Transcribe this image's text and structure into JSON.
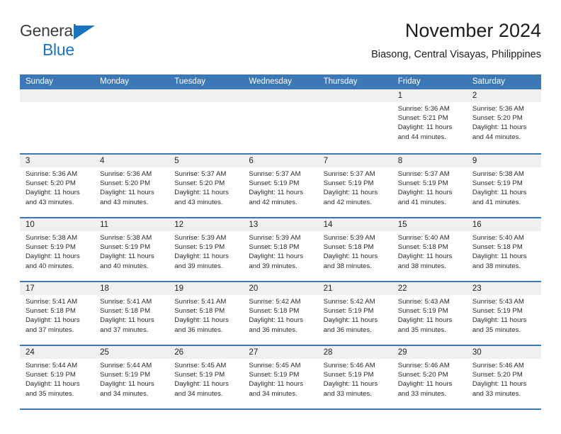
{
  "brand": {
    "name_part1": "General",
    "name_part2": "Blue",
    "accent_color": "#1a74bb"
  },
  "header": {
    "title": "November 2024",
    "subtitle": "Biasong, Central Visayas, Philippines"
  },
  "calendar": {
    "header_color": "#3b78b5",
    "day_header_bg": "#f0f0f0",
    "weekday_labels": [
      "Sunday",
      "Monday",
      "Tuesday",
      "Wednesday",
      "Thursday",
      "Friday",
      "Saturday"
    ],
    "weeks": [
      [
        {
          "day": "",
          "sunrise": "",
          "sunset": "",
          "daylight": "",
          "empty": true
        },
        {
          "day": "",
          "sunrise": "",
          "sunset": "",
          "daylight": "",
          "empty": true
        },
        {
          "day": "",
          "sunrise": "",
          "sunset": "",
          "daylight": "",
          "empty": true
        },
        {
          "day": "",
          "sunrise": "",
          "sunset": "",
          "daylight": "",
          "empty": true
        },
        {
          "day": "",
          "sunrise": "",
          "sunset": "",
          "daylight": "",
          "empty": true
        },
        {
          "day": "1",
          "sunrise": "Sunrise: 5:36 AM",
          "sunset": "Sunset: 5:21 PM",
          "daylight": "Daylight: 11 hours and 44 minutes."
        },
        {
          "day": "2",
          "sunrise": "Sunrise: 5:36 AM",
          "sunset": "Sunset: 5:20 PM",
          "daylight": "Daylight: 11 hours and 44 minutes."
        }
      ],
      [
        {
          "day": "3",
          "sunrise": "Sunrise: 5:36 AM",
          "sunset": "Sunset: 5:20 PM",
          "daylight": "Daylight: 11 hours and 43 minutes."
        },
        {
          "day": "4",
          "sunrise": "Sunrise: 5:36 AM",
          "sunset": "Sunset: 5:20 PM",
          "daylight": "Daylight: 11 hours and 43 minutes."
        },
        {
          "day": "5",
          "sunrise": "Sunrise: 5:37 AM",
          "sunset": "Sunset: 5:20 PM",
          "daylight": "Daylight: 11 hours and 43 minutes."
        },
        {
          "day": "6",
          "sunrise": "Sunrise: 5:37 AM",
          "sunset": "Sunset: 5:19 PM",
          "daylight": "Daylight: 11 hours and 42 minutes."
        },
        {
          "day": "7",
          "sunrise": "Sunrise: 5:37 AM",
          "sunset": "Sunset: 5:19 PM",
          "daylight": "Daylight: 11 hours and 42 minutes."
        },
        {
          "day": "8",
          "sunrise": "Sunrise: 5:37 AM",
          "sunset": "Sunset: 5:19 PM",
          "daylight": "Daylight: 11 hours and 41 minutes."
        },
        {
          "day": "9",
          "sunrise": "Sunrise: 5:38 AM",
          "sunset": "Sunset: 5:19 PM",
          "daylight": "Daylight: 11 hours and 41 minutes."
        }
      ],
      [
        {
          "day": "10",
          "sunrise": "Sunrise: 5:38 AM",
          "sunset": "Sunset: 5:19 PM",
          "daylight": "Daylight: 11 hours and 40 minutes."
        },
        {
          "day": "11",
          "sunrise": "Sunrise: 5:38 AM",
          "sunset": "Sunset: 5:19 PM",
          "daylight": "Daylight: 11 hours and 40 minutes."
        },
        {
          "day": "12",
          "sunrise": "Sunrise: 5:39 AM",
          "sunset": "Sunset: 5:19 PM",
          "daylight": "Daylight: 11 hours and 39 minutes."
        },
        {
          "day": "13",
          "sunrise": "Sunrise: 5:39 AM",
          "sunset": "Sunset: 5:18 PM",
          "daylight": "Daylight: 11 hours and 39 minutes."
        },
        {
          "day": "14",
          "sunrise": "Sunrise: 5:39 AM",
          "sunset": "Sunset: 5:18 PM",
          "daylight": "Daylight: 11 hours and 38 minutes."
        },
        {
          "day": "15",
          "sunrise": "Sunrise: 5:40 AM",
          "sunset": "Sunset: 5:18 PM",
          "daylight": "Daylight: 11 hours and 38 minutes."
        },
        {
          "day": "16",
          "sunrise": "Sunrise: 5:40 AM",
          "sunset": "Sunset: 5:18 PM",
          "daylight": "Daylight: 11 hours and 38 minutes."
        }
      ],
      [
        {
          "day": "17",
          "sunrise": "Sunrise: 5:41 AM",
          "sunset": "Sunset: 5:18 PM",
          "daylight": "Daylight: 11 hours and 37 minutes."
        },
        {
          "day": "18",
          "sunrise": "Sunrise: 5:41 AM",
          "sunset": "Sunset: 5:18 PM",
          "daylight": "Daylight: 11 hours and 37 minutes."
        },
        {
          "day": "19",
          "sunrise": "Sunrise: 5:41 AM",
          "sunset": "Sunset: 5:18 PM",
          "daylight": "Daylight: 11 hours and 36 minutes."
        },
        {
          "day": "20",
          "sunrise": "Sunrise: 5:42 AM",
          "sunset": "Sunset: 5:18 PM",
          "daylight": "Daylight: 11 hours and 36 minutes."
        },
        {
          "day": "21",
          "sunrise": "Sunrise: 5:42 AM",
          "sunset": "Sunset: 5:19 PM",
          "daylight": "Daylight: 11 hours and 36 minutes."
        },
        {
          "day": "22",
          "sunrise": "Sunrise: 5:43 AM",
          "sunset": "Sunset: 5:19 PM",
          "daylight": "Daylight: 11 hours and 35 minutes."
        },
        {
          "day": "23",
          "sunrise": "Sunrise: 5:43 AM",
          "sunset": "Sunset: 5:19 PM",
          "daylight": "Daylight: 11 hours and 35 minutes."
        }
      ],
      [
        {
          "day": "24",
          "sunrise": "Sunrise: 5:44 AM",
          "sunset": "Sunset: 5:19 PM",
          "daylight": "Daylight: 11 hours and 35 minutes."
        },
        {
          "day": "25",
          "sunrise": "Sunrise: 5:44 AM",
          "sunset": "Sunset: 5:19 PM",
          "daylight": "Daylight: 11 hours and 34 minutes."
        },
        {
          "day": "26",
          "sunrise": "Sunrise: 5:45 AM",
          "sunset": "Sunset: 5:19 PM",
          "daylight": "Daylight: 11 hours and 34 minutes."
        },
        {
          "day": "27",
          "sunrise": "Sunrise: 5:45 AM",
          "sunset": "Sunset: 5:19 PM",
          "daylight": "Daylight: 11 hours and 34 minutes."
        },
        {
          "day": "28",
          "sunrise": "Sunrise: 5:46 AM",
          "sunset": "Sunset: 5:19 PM",
          "daylight": "Daylight: 11 hours and 33 minutes."
        },
        {
          "day": "29",
          "sunrise": "Sunrise: 5:46 AM",
          "sunset": "Sunset: 5:20 PM",
          "daylight": "Daylight: 11 hours and 33 minutes."
        },
        {
          "day": "30",
          "sunrise": "Sunrise: 5:46 AM",
          "sunset": "Sunset: 5:20 PM",
          "daylight": "Daylight: 11 hours and 33 minutes."
        }
      ]
    ]
  }
}
